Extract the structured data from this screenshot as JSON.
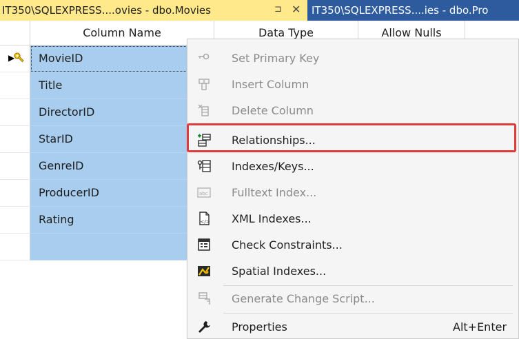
{
  "tabs": {
    "active": {
      "label": "IT350\\SQLEXPRESS....ovies - dbo.Movies",
      "pin": "⊐",
      "close": "✕"
    },
    "inactive": {
      "label": "IT350\\SQLEXPRESS....ies - dbo.Pro"
    }
  },
  "grid": {
    "headers": {
      "column_name": "Column Name",
      "data_type": "Data Type",
      "allow_nulls": "Allow Nulls"
    },
    "rows": [
      "MovieID",
      "Title",
      "DirectorID",
      "StarID",
      "GenreID",
      "ProducerID",
      "Rating",
      ""
    ]
  },
  "menu": {
    "items": [
      {
        "label": "Set Primary Key",
        "icon": "primary-key-icon",
        "disabled": true
      },
      {
        "label": "Insert Column",
        "icon": "insert-column-icon",
        "disabled": true
      },
      {
        "label": "Delete Column",
        "icon": "delete-column-icon",
        "disabled": true
      },
      {
        "label": "Relationships...",
        "icon": "relationships-icon",
        "disabled": false,
        "highlighted": true
      },
      {
        "label": "Indexes/Keys...",
        "icon": "indexes-keys-icon",
        "disabled": false
      },
      {
        "label": "Fulltext Index...",
        "icon": "fulltext-index-icon",
        "disabled": true
      },
      {
        "label": "XML Indexes...",
        "icon": "xml-indexes-icon",
        "disabled": false
      },
      {
        "label": "Check Constraints...",
        "icon": "check-constraints-icon",
        "disabled": false
      },
      {
        "label": "Spatial Indexes...",
        "icon": "spatial-indexes-icon",
        "disabled": false
      },
      {
        "label": "Generate Change Script...",
        "icon": "generate-script-icon",
        "disabled": true
      },
      {
        "label": "Properties",
        "icon": "wrench-icon",
        "disabled": false,
        "shortcut": "Alt+Enter"
      }
    ]
  },
  "colors": {
    "active_tab": "#ffe98a",
    "inactive_tab": "#2d5b9e",
    "selected_row": "#a8cdee",
    "highlight_border": "#e03b3b"
  }
}
